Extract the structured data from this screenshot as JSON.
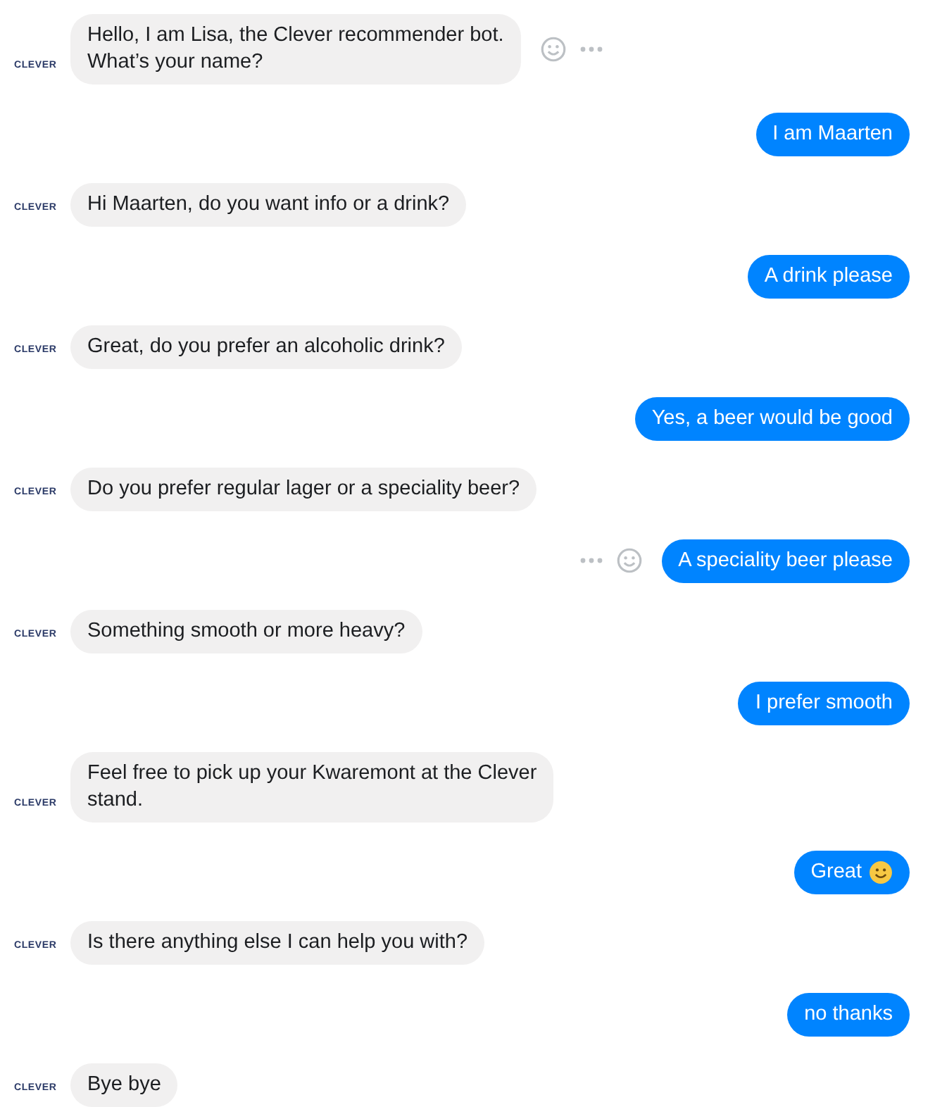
{
  "messages": [
    {
      "kind": "bot",
      "logo": "CLEVER",
      "text": "Hello, I am Lisa, the Clever recommender bot.\nWhat’s your name?",
      "reactions_shown": true
    },
    {
      "kind": "user",
      "text": "I am Maarten",
      "reactions_shown": false
    },
    {
      "kind": "bot",
      "logo": "CLEVER",
      "text": "Hi Maarten, do you want info or a drink?",
      "reactions_shown": false
    },
    {
      "kind": "user",
      "text": "A drink please",
      "reactions_shown": false
    },
    {
      "kind": "bot",
      "logo": "CLEVER",
      "text": "Great, do you prefer an alcoholic drink?",
      "reactions_shown": false
    },
    {
      "kind": "user",
      "text": "Yes, a beer would be good",
      "reactions_shown": false
    },
    {
      "kind": "bot",
      "logo": "CLEVER",
      "text": "Do you prefer regular lager or a speciality beer?",
      "reactions_shown": false
    },
    {
      "kind": "user",
      "text": "A speciality beer please",
      "reactions_shown": true
    },
    {
      "kind": "bot",
      "logo": "CLEVER",
      "text": "Something smooth or more heavy?",
      "reactions_shown": false
    },
    {
      "kind": "user",
      "text": "I prefer smooth",
      "reactions_shown": false
    },
    {
      "kind": "bot",
      "logo": "CLEVER",
      "text": "Feel free to pick up your Kwaremont at the Clever\nstand.",
      "reactions_shown": false
    },
    {
      "kind": "user",
      "text": "Great",
      "emoji": true,
      "reactions_shown": false
    },
    {
      "kind": "bot",
      "logo": "CLEVER",
      "text": "Is there anything else I can help you with?",
      "reactions_shown": false
    },
    {
      "kind": "user",
      "text": "no thanks",
      "reactions_shown": false
    },
    {
      "kind": "bot",
      "logo": "CLEVER",
      "text": "Bye bye",
      "reactions_shown": false
    }
  ]
}
